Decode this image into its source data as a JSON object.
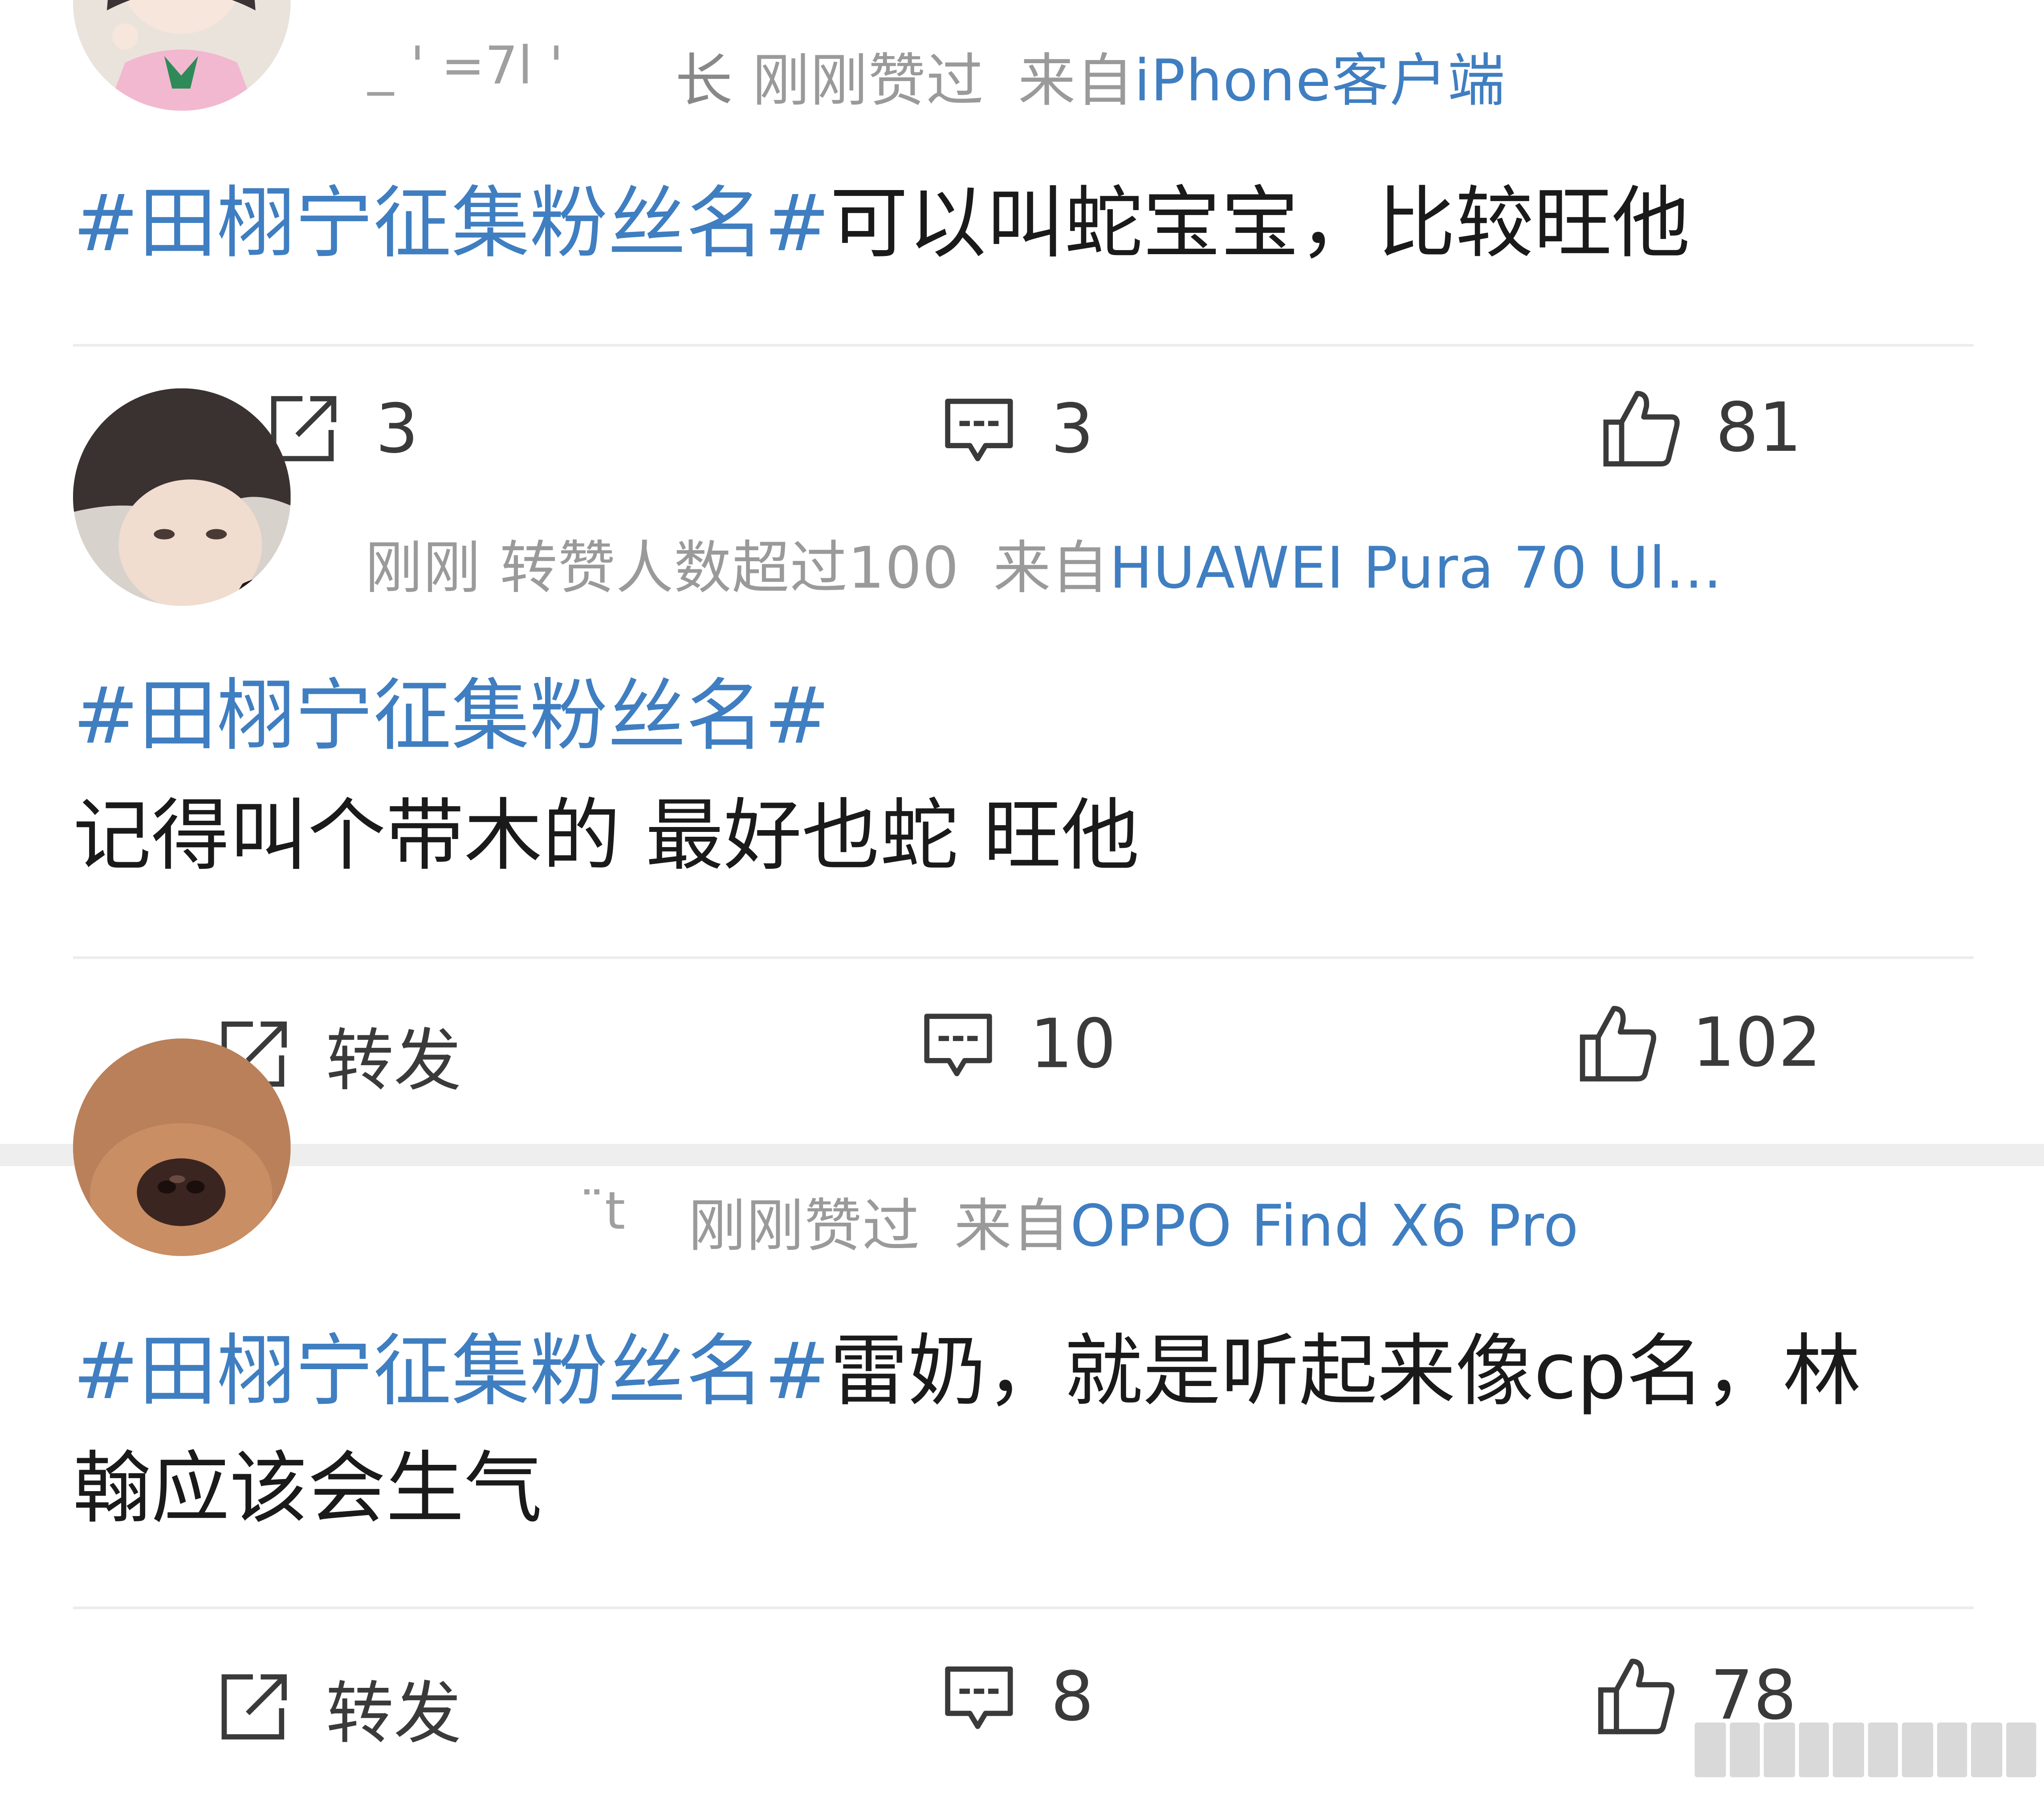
{
  "posts": [
    {
      "username": "_ ' =7l '",
      "username_suffix": "长",
      "status": "刚刚赞过",
      "source_prefix": "来自",
      "source": "iPhone客户端",
      "hashtag": "#田栩宁征集粉丝名#",
      "text": "可以叫蛇宝宝，比较旺他",
      "text_line2": "",
      "repost": "3",
      "comments": "3",
      "likes": "81"
    },
    {
      "username": "",
      "username_suffix": "",
      "status": "刚刚 转赞人数超过100",
      "source_prefix": "来自",
      "source": "HUAWEI Pura 70 Ul...",
      "hashtag": "#田栩宁征集粉丝名#",
      "text": "",
      "text_line2": "记得叫个带木的 最好也蛇  旺他",
      "repost": "转发",
      "comments": "10",
      "likes": "102"
    },
    {
      "username": "",
      "username_suffix": "¨t",
      "status": "刚刚赞过",
      "source_prefix": "来自",
      "source": "OPPO Find X6 Pro",
      "hashtag": "#田栩宁征集粉丝名#",
      "text": "雷奶，就是听起来像cp名，林",
      "text_line2": "翰应该会生气",
      "repost": "转发",
      "comments": "8",
      "likes": "78"
    }
  ],
  "icons": {
    "repost": "repost-icon",
    "comment": "comment-icon",
    "like": "thumbs-up-icon"
  },
  "colors": {
    "link": "#3f7ec1",
    "meta": "#9a9a9a",
    "text": "#1a1a1a",
    "divider": "#ececec"
  }
}
